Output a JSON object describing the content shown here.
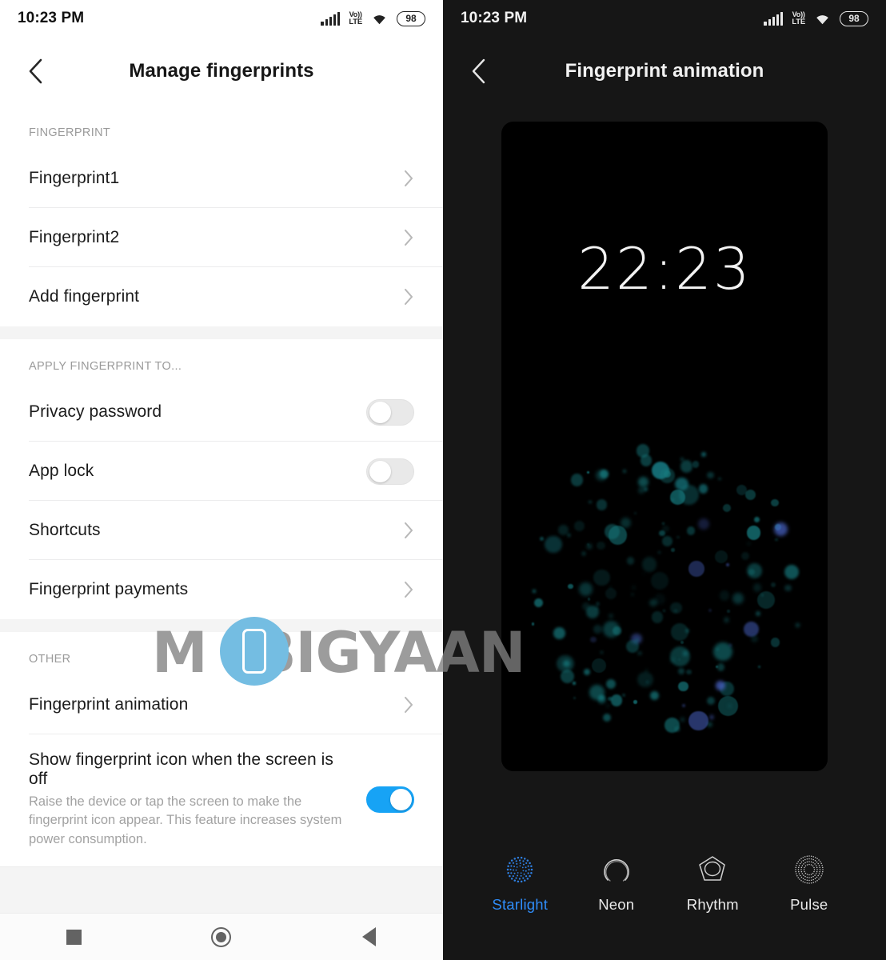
{
  "status_bar": {
    "time": "10:23 PM",
    "signal_icon": "signal-bars-icon",
    "volte_icon": "volte-icon",
    "volte_top": "Vo))",
    "volte_bottom": "LTE",
    "wifi_icon": "wifi-icon",
    "battery_level": "98"
  },
  "left_screen": {
    "title": "Manage fingerprints",
    "back_icon": "back-chevron-icon",
    "sections": [
      {
        "header": "FINGERPRINT",
        "rows": [
          {
            "label": "Fingerprint1",
            "type": "chevron"
          },
          {
            "label": "Fingerprint2",
            "type": "chevron"
          },
          {
            "label": "Add fingerprint",
            "type": "chevron"
          }
        ]
      },
      {
        "header": "APPLY FINGERPRINT TO...",
        "rows": [
          {
            "label": "Privacy password",
            "type": "toggle",
            "value": "off"
          },
          {
            "label": "App lock",
            "type": "toggle",
            "value": "off"
          },
          {
            "label": "Shortcuts",
            "type": "chevron"
          },
          {
            "label": "Fingerprint payments",
            "type": "chevron"
          }
        ]
      },
      {
        "header": "OTHER",
        "rows": [
          {
            "label": "Fingerprint animation",
            "type": "chevron"
          },
          {
            "label": "Show fingerprint icon when the screen is off",
            "sub": "Raise the device or tap the screen to make the fingerprint icon appear. This feature increases system power consumption.",
            "type": "toggle",
            "value": "on"
          }
        ]
      }
    ],
    "nav_bar": {
      "recents_icon": "square-recents-icon",
      "home_icon": "circle-home-icon",
      "back_icon": "triangle-back-icon"
    }
  },
  "right_screen": {
    "title": "Fingerprint animation",
    "back_icon": "back-chevron-icon",
    "preview": {
      "clock": "22:23",
      "animation": "starlight-particles"
    },
    "options": [
      {
        "label": "Starlight",
        "icon": "starlight-dots-icon",
        "selected": true
      },
      {
        "label": "Neon",
        "icon": "neon-arc-icon",
        "selected": false
      },
      {
        "label": "Rhythm",
        "icon": "rhythm-polygon-icon",
        "selected": false
      },
      {
        "label": "Pulse",
        "icon": "pulse-rings-icon",
        "selected": false
      }
    ]
  },
  "watermark": {
    "text_before": "M",
    "text_after": "BIGYAAN",
    "logo": "mobigyaan-phone-logo"
  },
  "colors": {
    "accent_blue": "#17a3f5",
    "selected_option": "#2f8dfa",
    "particle_teal": "#1f8f8f",
    "dark_bg": "#161616"
  }
}
